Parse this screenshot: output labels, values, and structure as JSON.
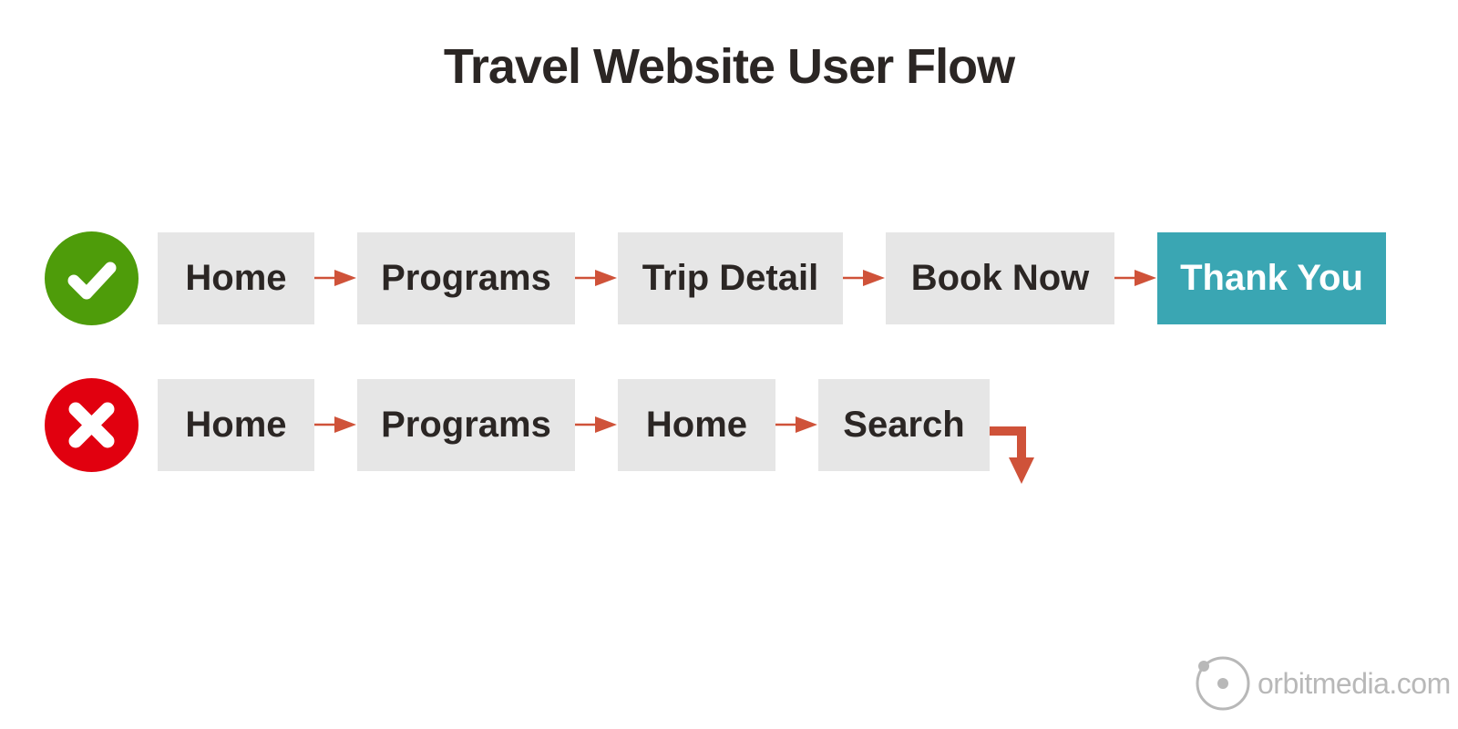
{
  "title": "Travel Website User Flow",
  "colors": {
    "success": "#4e9c0a",
    "failure": "#e1000f",
    "step_bg": "#e6e6e6",
    "final_step_bg": "#3aa6b3",
    "arrow": "#cf5239",
    "text": "#2b2624",
    "logo": "#b8b8b8"
  },
  "flows": [
    {
      "status": "success",
      "status_icon": "check-icon",
      "steps": [
        "Home",
        "Programs",
        "Trip Detail",
        "Book Now",
        "Thank You"
      ],
      "end": "Thank You"
    },
    {
      "status": "failure",
      "status_icon": "x-icon",
      "steps": [
        "Home",
        "Programs",
        "Home",
        "Search"
      ],
      "end": "exit-down-arrow"
    }
  ],
  "branding": {
    "logo_icon": "orbit-icon",
    "text": "orbitmedia.com"
  }
}
